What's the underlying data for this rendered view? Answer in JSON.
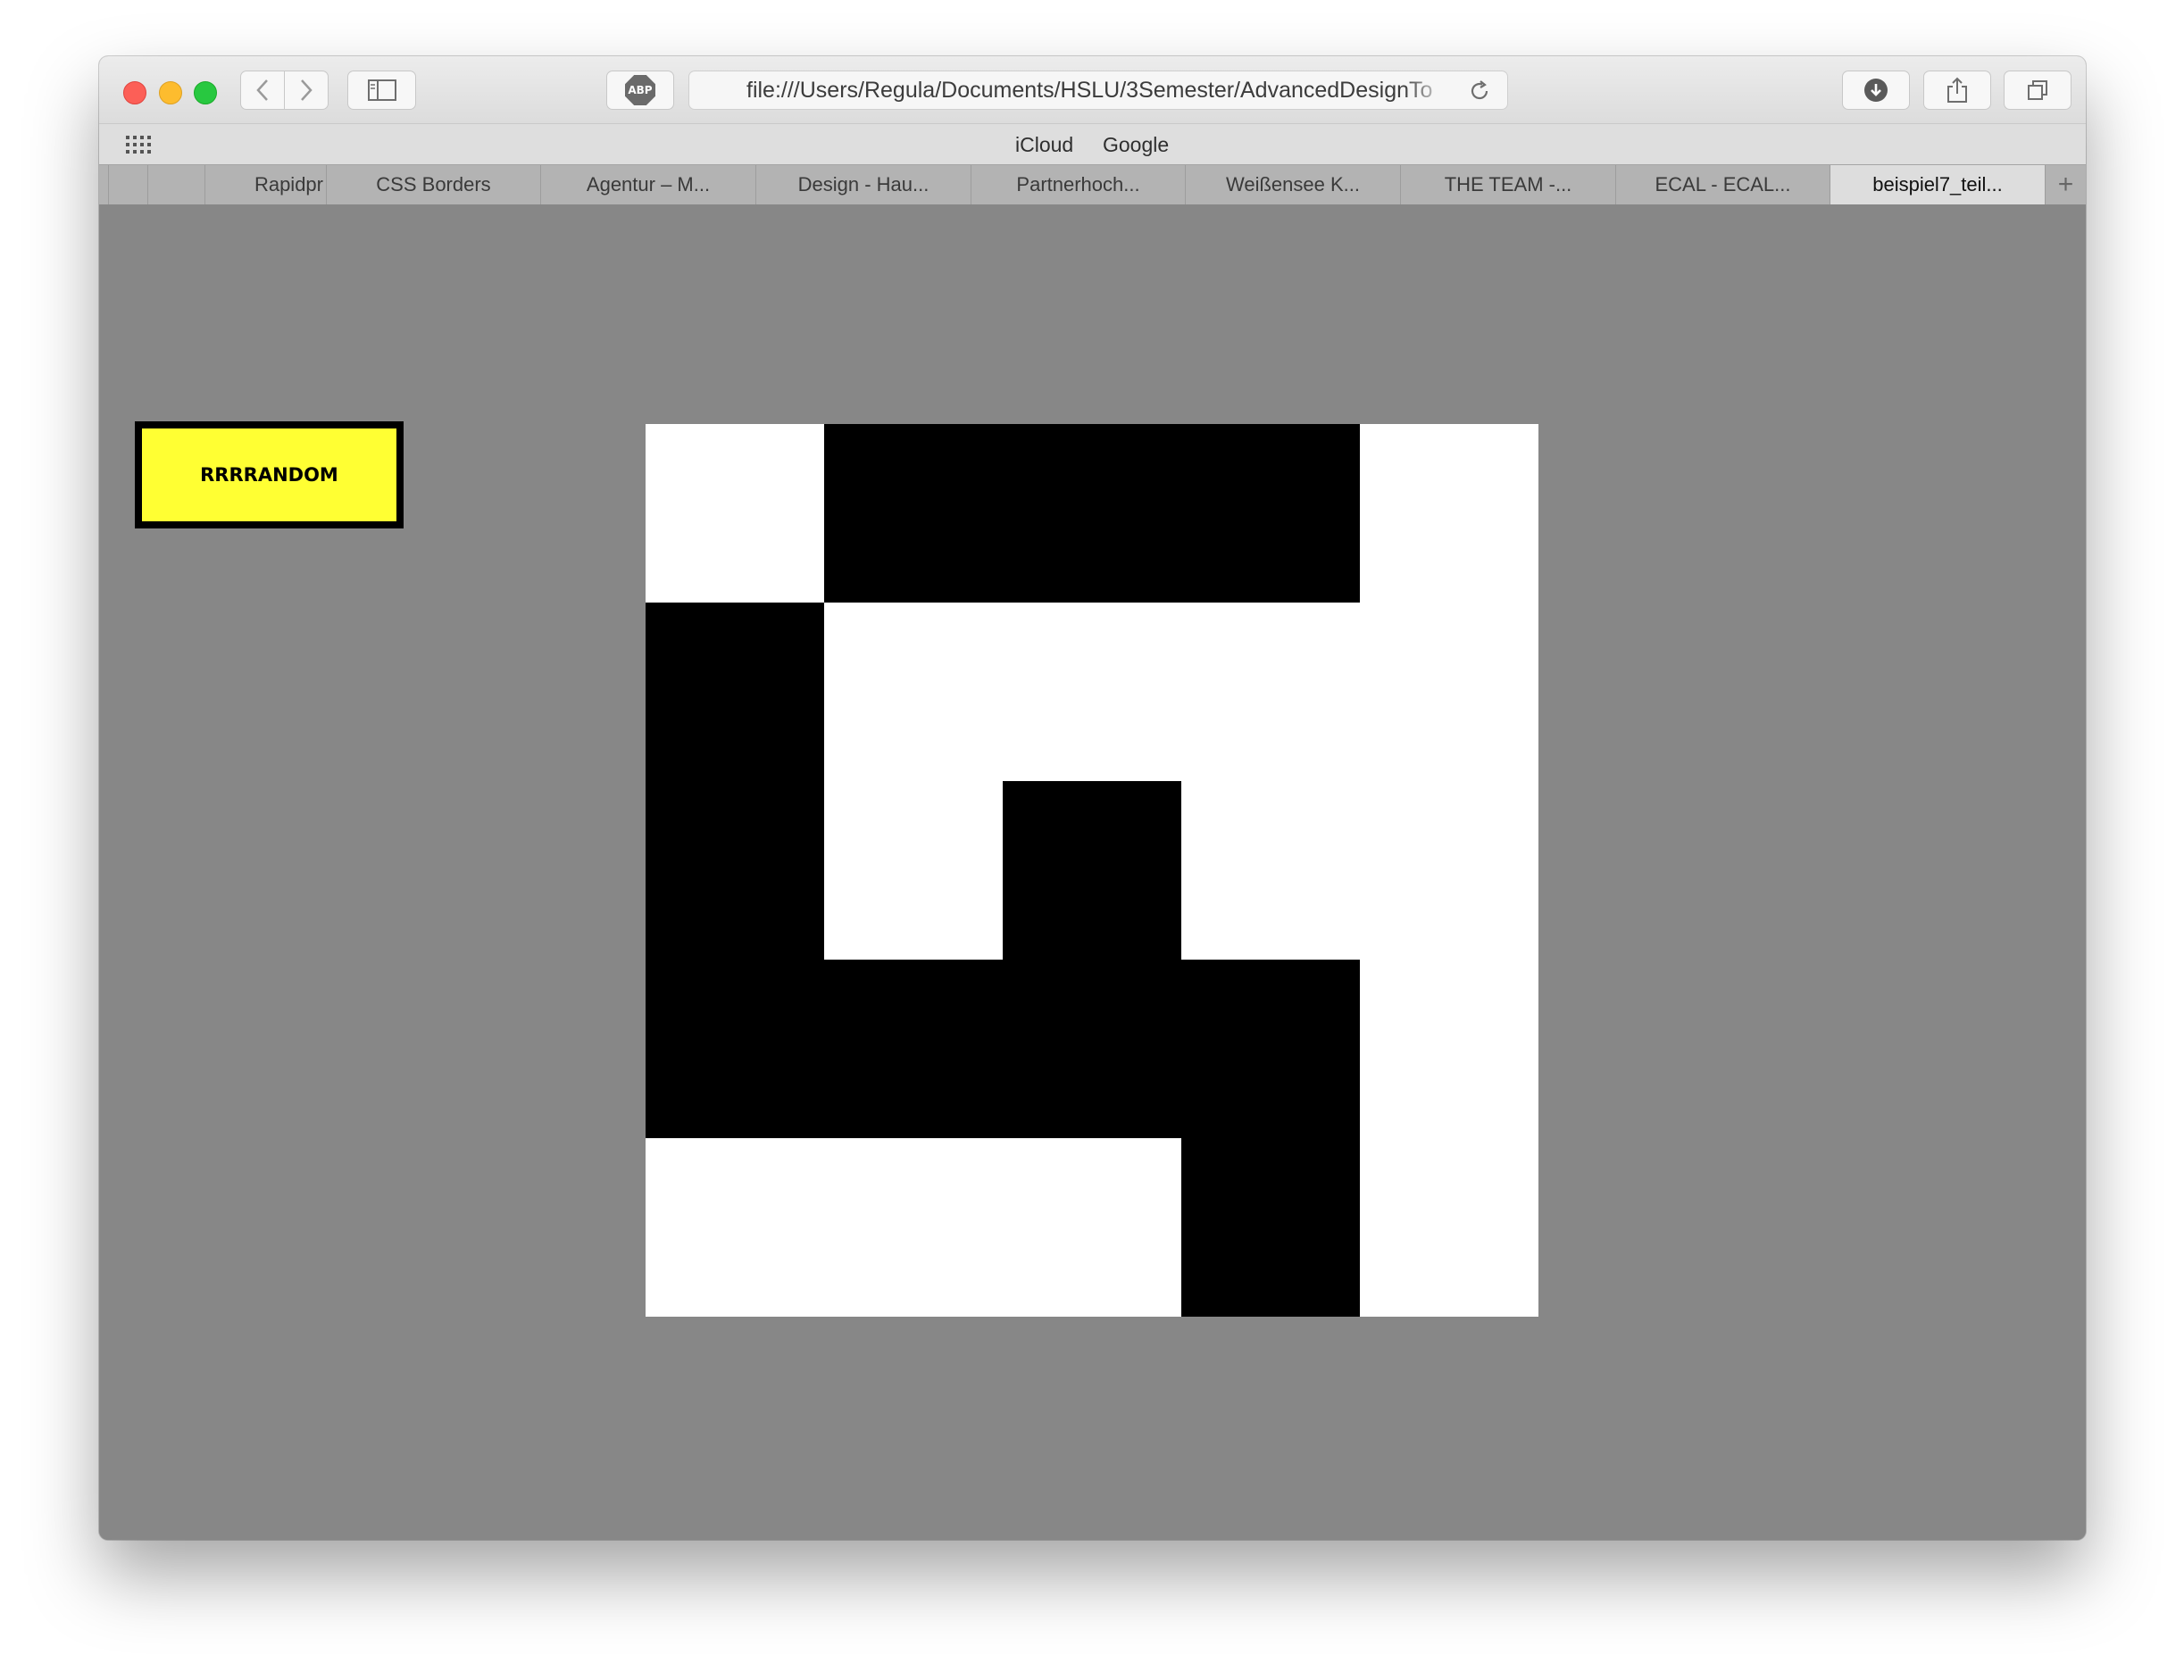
{
  "browser": {
    "url": "file:///Users/Regula/Documents/HSLU/3Semester/AdvancedDesignTo",
    "favorites": [
      "iCloud",
      "Google"
    ],
    "tabs": [
      {
        "label": ""
      },
      {
        "label": ""
      },
      {
        "label": "Rapidpr"
      },
      {
        "label": "CSS Borders"
      },
      {
        "label": "Agentur – M..."
      },
      {
        "label": "Design - Hau..."
      },
      {
        "label": "Partnerhoch..."
      },
      {
        "label": "Weißensee K..."
      },
      {
        "label": "THE TEAM -..."
      },
      {
        "label": "ECAL - ECAL..."
      },
      {
        "label": "beispiel7_teil...",
        "active": true
      }
    ],
    "icons": {
      "adblock": "ABP",
      "new_tab": "+",
      "back": "chevron-left-icon",
      "forward": "chevron-right-icon",
      "sidebar": "sidebar-icon",
      "reload": "reload-icon",
      "download": "download-icon",
      "share": "share-icon",
      "tabs_overview": "tabs-icon",
      "top_sites": "grid-icon"
    }
  },
  "page": {
    "button_label": "RRRRANDOM",
    "button_color": "#ffff33",
    "background_color": "#878787",
    "grid_pattern": [
      [
        0,
        1,
        1,
        1,
        0
      ],
      [
        1,
        0,
        0,
        0,
        0
      ],
      [
        1,
        0,
        1,
        0,
        0
      ],
      [
        1,
        1,
        1,
        1,
        0
      ],
      [
        0,
        0,
        0,
        1,
        0
      ]
    ],
    "fill_color": "#000000",
    "empty_color": "#ffffff"
  }
}
